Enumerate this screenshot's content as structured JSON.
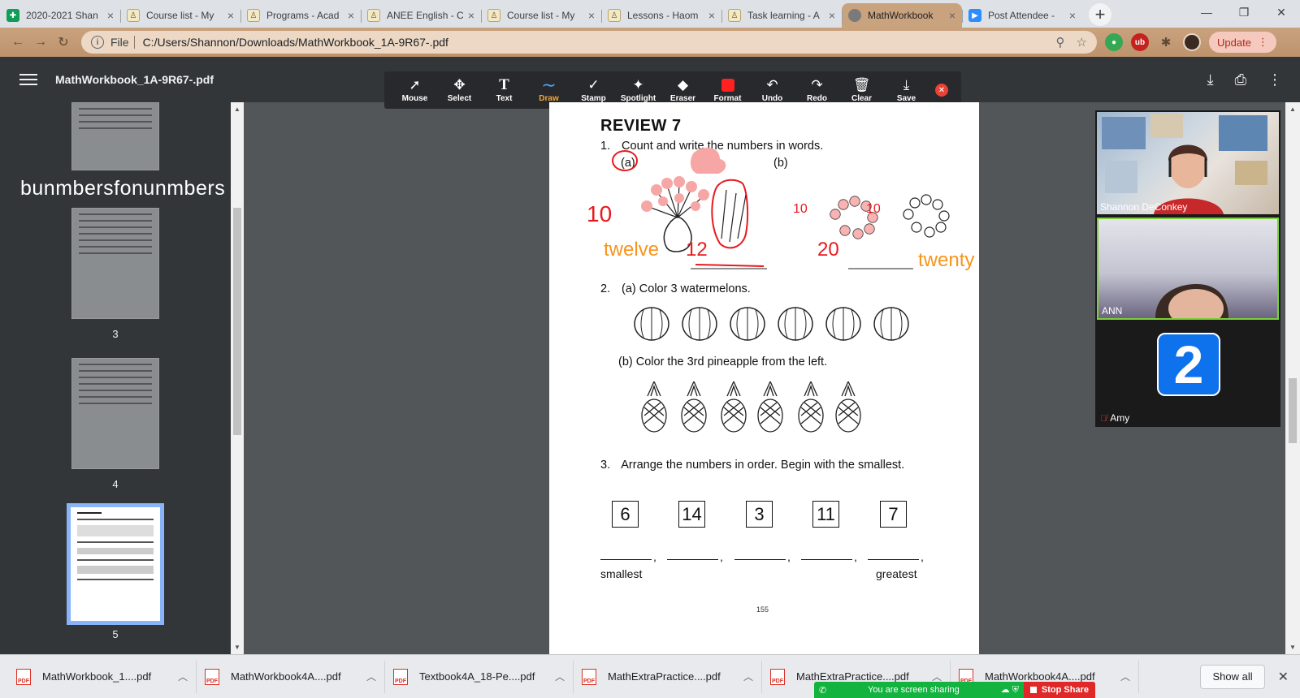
{
  "tabs": [
    {
      "label": "2020-2021 Shan",
      "icon": "sheets"
    },
    {
      "label": "Course list - My",
      "icon": "doc"
    },
    {
      "label": "Programs - Acad",
      "icon": "doc"
    },
    {
      "label": "ANEE English - C",
      "icon": "doc"
    },
    {
      "label": "Course list - My",
      "icon": "doc"
    },
    {
      "label": "Lessons - Haom",
      "icon": "doc"
    },
    {
      "label": "Task learning - A",
      "icon": "doc"
    },
    {
      "label": "MathWorkbook",
      "icon": "globe",
      "active": true
    },
    {
      "label": "Post Attendee -",
      "icon": "zoom"
    }
  ],
  "address": {
    "scheme": "File",
    "url": "C:/Users/Shannon/Downloads/MathWorkbook_1A-9R67-.pdf",
    "update_label": "Update"
  },
  "pdf": {
    "title": "MathWorkbook_1A-9R67-.pdf"
  },
  "annotation_tools": [
    {
      "label": "Mouse",
      "glyph": "➚"
    },
    {
      "label": "Select",
      "glyph": "✥"
    },
    {
      "label": "Text",
      "glyph": "T"
    },
    {
      "label": "Draw",
      "glyph": "∼",
      "active": true
    },
    {
      "label": "Stamp",
      "glyph": "✓"
    },
    {
      "label": "Spotlight",
      "glyph": "✦"
    },
    {
      "label": "Eraser",
      "glyph": "◆"
    },
    {
      "label": "Format",
      "glyph": ""
    },
    {
      "label": "Undo",
      "glyph": "↶"
    },
    {
      "label": "Redo",
      "glyph": "↷"
    },
    {
      "label": "Clear",
      "glyph": "🗑"
    },
    {
      "label": "Save",
      "glyph": "⤓"
    }
  ],
  "thumbnails": {
    "overlay_text": "bunmbersfonunmbers",
    "pages": [
      "3",
      "4",
      "5"
    ]
  },
  "worksheet": {
    "heading": "REVIEW 7",
    "q1_num": "1.",
    "q1_text": "Count and write the numbers in words.",
    "q1_a": "(a)",
    "q1_b": "(b)",
    "ann_10_left": "10",
    "ann_twelve": "twelve",
    "ann_12": "12",
    "ann_ring1": "10",
    "ann_ring2": "10",
    "ann_20": "20",
    "ann_twenty": "twenty",
    "q2_num": "2.",
    "q2_a": "(a)  Color 3 watermelons.",
    "q2_b": "(b)  Color the 3rd pineapple from the left.",
    "q3_num": "3.",
    "q3_text": "Arrange the numbers in order. Begin with the smallest.",
    "numbers": [
      "6",
      "14",
      "3",
      "11",
      "7"
    ],
    "smallest": "smallest",
    "greatest": "greatest",
    "page_number": "155"
  },
  "zoom": {
    "participants": [
      {
        "name": "Shannon DeConkey"
      },
      {
        "name": "ANN"
      },
      {
        "name": "Amy",
        "avatar": "2"
      }
    ],
    "share_text": "You are screen sharing",
    "stop_label": "Stop Share"
  },
  "downloads": {
    "items": [
      "MathWorkbook_1....pdf",
      "MathWorkbook4A....pdf",
      "Textbook4A_18-Pe....pdf",
      "MathExtraPractice....pdf",
      "MathExtraPractice....pdf",
      "MathWorkbook4A....pdf"
    ],
    "show_all": "Show all"
  },
  "colors": {
    "active_tab": "#c9a27e",
    "annotation_red": "#e8191e",
    "annotation_orange": "#f7941d",
    "annotation_pink": "#f7a6a6",
    "share_green": "#12b33e"
  }
}
